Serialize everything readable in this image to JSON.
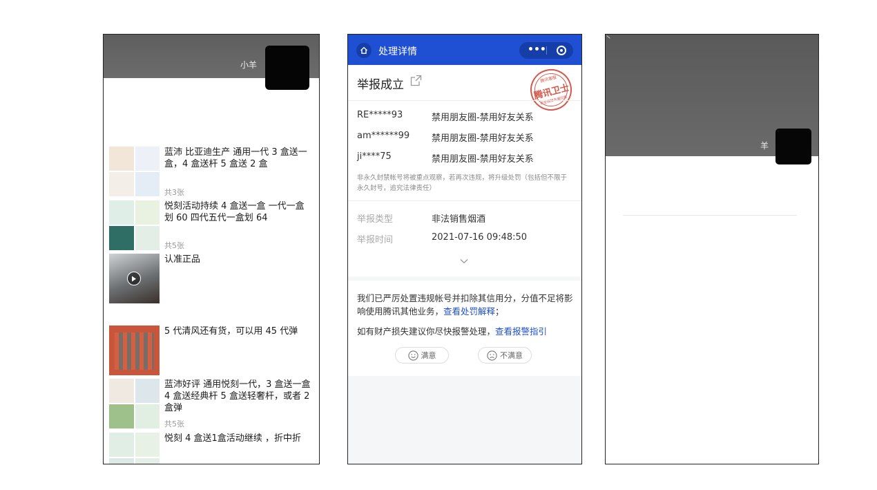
{
  "panel1": {
    "username": "小羊",
    "posts": [
      {
        "text": "蓝沛 比亚迪生产 通用一代 3 盒送一盒，4 盒送杆 5 盒送 2 盒",
        "count": "共3张"
      },
      {
        "text": "悦刻活动持续 4 盒送一盒 一代一盒划 60 四代五代一盒划 64",
        "count": "共5张"
      },
      {
        "text": "认准正品",
        "count": ""
      },
      {
        "text": "5 代清风还有货，可以用 45 代弹",
        "count": ""
      },
      {
        "text": "蓝沛好评 通用悦刻一代，3 盒送一盒 4 盒送经典杆 5 盒送轻奢杆，或者 2 盒弹",
        "count": "共5张"
      },
      {
        "text": "悦刻 4 盒送1盒活动继续 ，折中折",
        "count": ""
      }
    ],
    "icons": [
      "play-icon"
    ]
  },
  "panel2": {
    "nav": {
      "title": "处理详情",
      "more": "•••"
    },
    "result_title": "举报成立",
    "stamp": {
      "main": "腾讯卫士",
      "top": "腾讯客服",
      "bottom": "安全保障专属印章"
    },
    "accounts": [
      {
        "id": "RE*****93",
        "status": "禁用朋友圈-禁用好友关系"
      },
      {
        "id": "am******99",
        "status": "禁用朋友圈-禁用好友关系"
      },
      {
        "id": "ji****75",
        "status": "禁用朋友圈-禁用好友关系"
      }
    ],
    "note": "非永久封禁帐号将被重点观察，若再次违规，将升级处罚（包括但不限于永久封号，追究法律责任）",
    "report_type": {
      "label": "举报类型",
      "value": "非法销售烟酒"
    },
    "report_time": {
      "label": "举报时间",
      "value": "2021-07-16 09:48:50"
    },
    "message1": "我们已严厉处置违规帐号并扣除其信用分，分值不足将影响使用腾讯其他业务，",
    "message1_link": "查看处罚解释",
    "message1_end": "；",
    "message2": "如有财产损失建议你尽快报警处理，",
    "message2_link": "查看报警指引",
    "satisfied": "满意",
    "unsatisfied": "不满意",
    "colors": {
      "nav": "#1f4fd2",
      "link": "#1f4fd2",
      "stamp": "#d24a3c"
    }
  },
  "panel3": {
    "username": "羊"
  }
}
